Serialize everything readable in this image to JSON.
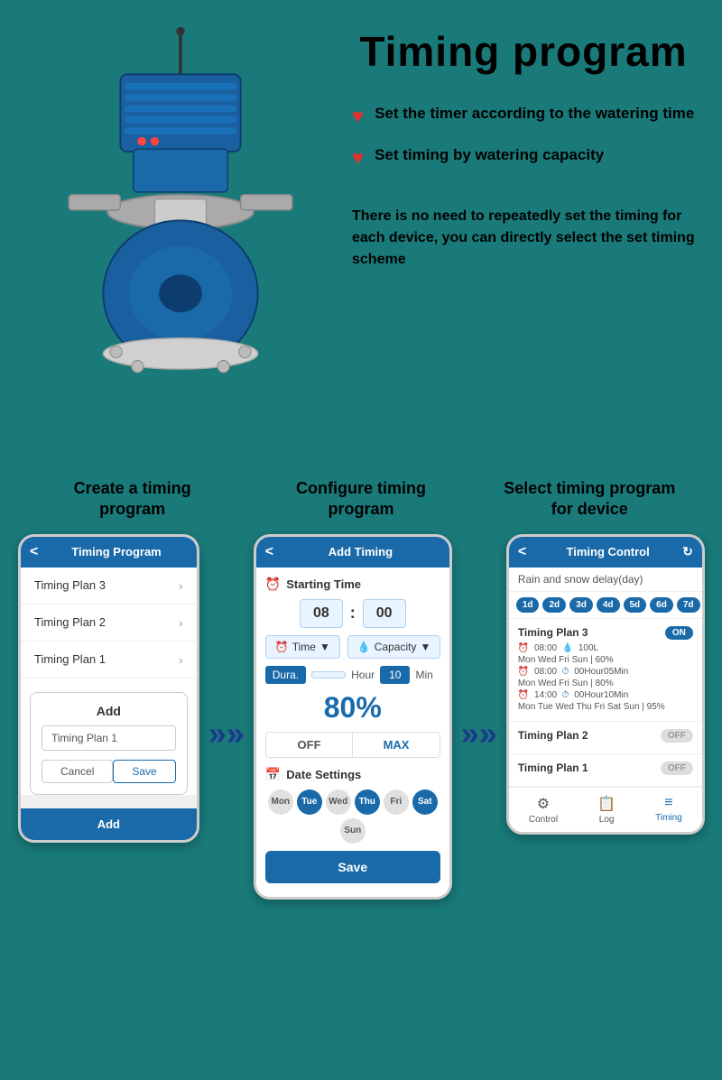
{
  "page": {
    "background_color": "#1a7a7a",
    "title": "Timing program"
  },
  "top": {
    "main_title": "Timing program",
    "features": [
      {
        "id": "feature1",
        "text": "Set the timer according to the watering time"
      },
      {
        "id": "feature2",
        "text": "Set timing by watering capacity"
      }
    ],
    "description": "There is no need to repeatedly set the timing for each device, you can directly select the set timing scheme"
  },
  "steps": [
    {
      "id": "step1",
      "title": "Create a timing program"
    },
    {
      "id": "step2",
      "title": "Configure timing program"
    },
    {
      "id": "step3",
      "title": "Select timing program for device"
    }
  ],
  "phone1": {
    "header_title": "Timing Program",
    "back_label": "<",
    "plans": [
      "Timing Plan 3",
      "Timing Plan 2",
      "Timing Plan 1"
    ],
    "modal_title": "Add",
    "modal_input_value": "Timing Plan 1",
    "cancel_label": "Cancel",
    "save_label": "Save",
    "add_footer": "Add"
  },
  "phone2": {
    "header_title": "Add Timing",
    "back_label": "<",
    "starting_time_label": "Starting Time",
    "hour": "08",
    "minute": "00",
    "time_label": "Time",
    "capacity_label": "Capacity",
    "dura_label": "Dura.",
    "hour_label": "Hour",
    "min_value": "10",
    "min_label": "Min",
    "percent": "80%",
    "off_label": "OFF",
    "max_label": "MAX",
    "date_settings_label": "Date Settings",
    "days": [
      {
        "label": "Mon",
        "active": false
      },
      {
        "label": "Tue",
        "active": true
      },
      {
        "label": "Wed",
        "active": false
      },
      {
        "label": "Thu",
        "active": true
      },
      {
        "label": "Fri",
        "active": false
      },
      {
        "label": "Sat",
        "active": true
      },
      {
        "label": "Sun",
        "active": false
      }
    ],
    "save_label": "Save"
  },
  "phone3": {
    "header_title": "Timing Control",
    "back_label": "<",
    "refresh_icon": "↻",
    "rain_snow_label": "Rain and snow delay(day)",
    "day_pills": [
      "1d",
      "2d",
      "3d",
      "4d",
      "5d",
      "6d",
      "7d"
    ],
    "plans": [
      {
        "name": "Timing Plan 3",
        "toggle": "ON",
        "details": [
          "⏰ 08:00  💧 100L",
          "Mon Wed Fri Sun | 60%",
          "⏰ 08:00  ⏱ 00Hour05Min",
          "Mon Wed Fri Sun | 80%",
          "⏰ 14:00  ⏱ 00Hour10Min",
          "Mon Tue Wed Thu Fri Sat Sun | 95%"
        ]
      },
      {
        "name": "Timing Plan 2",
        "toggle": "OFF"
      },
      {
        "name": "Timing Plan 1",
        "toggle": "OFF"
      }
    ],
    "footer_items": [
      {
        "label": "Control",
        "icon": "⚙",
        "active": false
      },
      {
        "label": "Log",
        "icon": "📋",
        "active": false
      },
      {
        "label": "Timing",
        "icon": "≡",
        "active": true
      }
    ]
  },
  "arrows": {
    "symbol": "»»"
  }
}
